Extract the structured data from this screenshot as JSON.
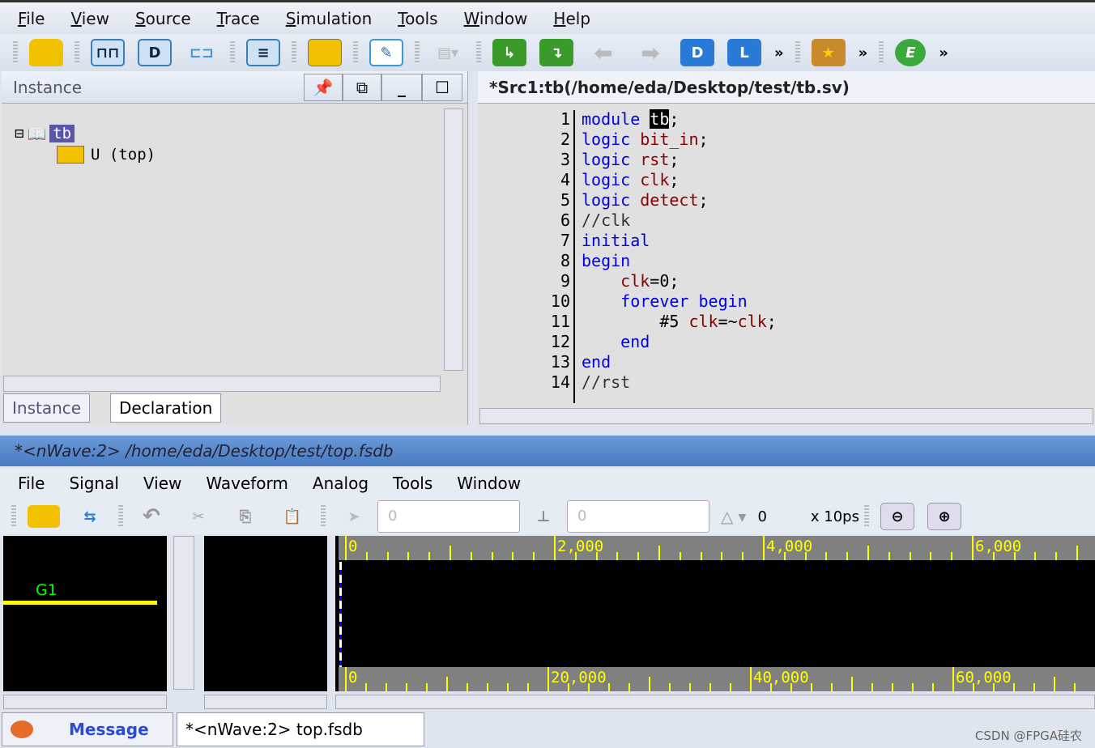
{
  "menu": [
    "File",
    "View",
    "Source",
    "Trace",
    "Simulation",
    "Tools",
    "Window",
    "Help"
  ],
  "toolbar": {
    "icons": [
      "open-folder-icon",
      "waveform-icon",
      "schematic-icon",
      "hierarchy-icon",
      "source-view-icon",
      "open-file-icon",
      "edit-icon",
      "report-icon",
      "trace-load-icon",
      "trace-driver-icon",
      "back-arrow-icon",
      "forward-arrow-icon",
      "driver-icon",
      "load-icon",
      "bookmark-icon",
      "e-icon"
    ],
    "labels": {
      "trace_load": "L",
      "trace_driver": "D",
      "e": "E"
    },
    "more": "»"
  },
  "instance_panel": {
    "title": "Instance",
    "tree": [
      {
        "label": "tb",
        "selected": true
      },
      {
        "label": "U (top)"
      }
    ],
    "tabs": [
      "Instance",
      "Declaration"
    ]
  },
  "source": {
    "title": "*Src1:tb(/home/eda/Desktop/test/tb.sv)",
    "lines": [
      [
        [
          "kw",
          "module "
        ],
        [
          "sel",
          "tb"
        ],
        [
          "pn",
          ";"
        ]
      ],
      [
        [
          "kw",
          "logic "
        ],
        [
          "id",
          "bit_in"
        ],
        [
          "pn",
          ";"
        ]
      ],
      [
        [
          "kw",
          "logic "
        ],
        [
          "id",
          "rst"
        ],
        [
          "pn",
          ";"
        ]
      ],
      [
        [
          "kw",
          "logic "
        ],
        [
          "id",
          "clk"
        ],
        [
          "pn",
          ";"
        ]
      ],
      [
        [
          "kw",
          "logic "
        ],
        [
          "id",
          "detect"
        ],
        [
          "pn",
          ";"
        ]
      ],
      [
        [
          "cm",
          "//clk"
        ]
      ],
      [
        [
          "kw",
          "initial"
        ]
      ],
      [
        [
          "kw",
          "begin"
        ]
      ],
      [
        [
          "pn",
          "    "
        ],
        [
          "id",
          "clk"
        ],
        [
          "pn",
          "=0;"
        ]
      ],
      [
        [
          "pn",
          "    "
        ],
        [
          "kw",
          "forever begin"
        ]
      ],
      [
        [
          "pn",
          "        #5 "
        ],
        [
          "id",
          "clk"
        ],
        [
          "pn",
          "=~"
        ],
        [
          "id",
          "clk"
        ],
        [
          "pn",
          ";"
        ]
      ],
      [
        [
          "pn",
          "    "
        ],
        [
          "kw",
          "end"
        ]
      ],
      [
        [
          "kw",
          "end"
        ]
      ],
      [
        [
          "cm",
          "//rst"
        ]
      ]
    ]
  },
  "nwave": {
    "title": "*<nWave:2> /home/eda/Desktop/test/top.fsdb",
    "menu": [
      "File",
      "Signal",
      "View",
      "Waveform",
      "Analog",
      "Tools",
      "Window"
    ],
    "cursor_value": "0",
    "marker_value": "0",
    "delta": "0",
    "unit": "x 10ps",
    "group": "G1",
    "ruler_top": [
      "0",
      "2,000",
      "4,000",
      "6,000"
    ],
    "ruler_bottom": [
      "0",
      "20,000",
      "40,000",
      "60,000"
    ]
  },
  "bottom_tabs": [
    "Message",
    "*<nWave:2> top.fsdb"
  ],
  "watermark": "CSDN @FPGA硅农"
}
